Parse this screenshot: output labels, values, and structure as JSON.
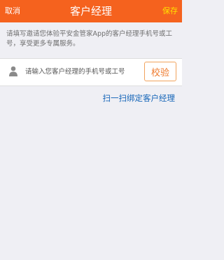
{
  "navbar": {
    "cancel_label": "取消",
    "title": "客户经理",
    "save_label": "保存",
    "background_color": "#f5621e",
    "save_color": "#ffe000"
  },
  "intro": {
    "text": "请填写邀请您体验平安金管家App的客户经理手机号或工号，享受更多专属服务。"
  },
  "form": {
    "input_icon": "user-icon",
    "input_value": "",
    "input_placeholder": "请输入您客户经理的手机号或工号",
    "verify_label": "校验"
  },
  "scan": {
    "label": "扫一扫绑定客户经理",
    "link_color": "#1565b8"
  }
}
